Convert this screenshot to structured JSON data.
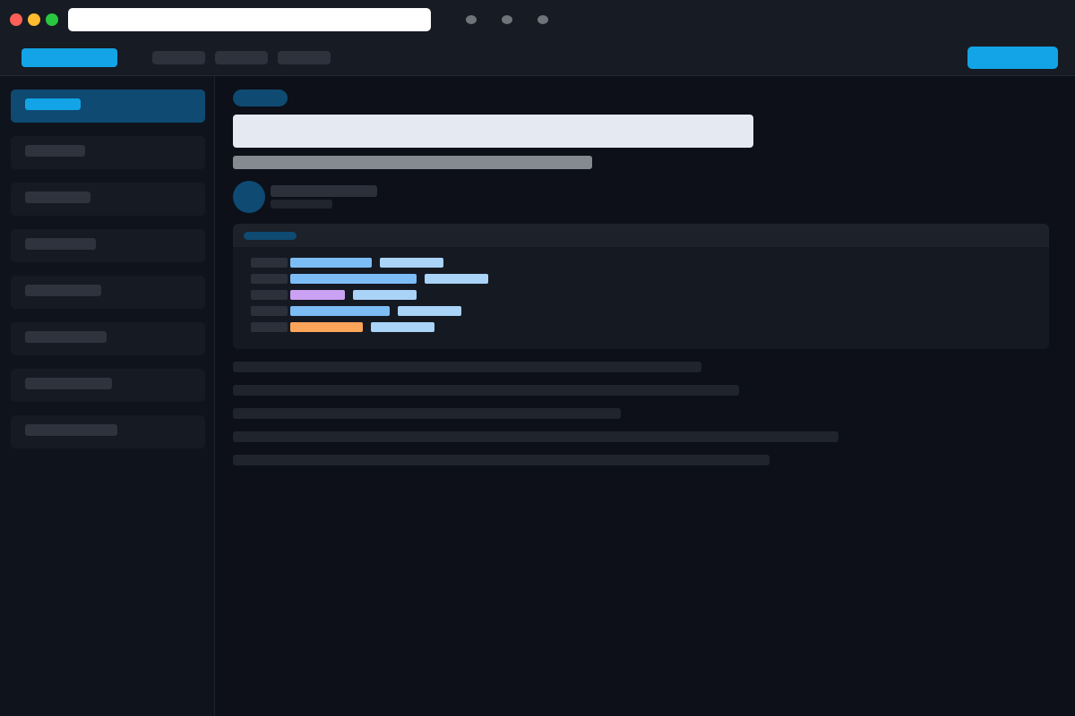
{
  "window": {
    "controls": [
      "close",
      "minimize",
      "maximize"
    ],
    "address_bar": {
      "value": ""
    },
    "toolbar_icons": [
      "dot-icon",
      "dot-icon",
      "dot-icon"
    ]
  },
  "header": {
    "brand": "",
    "nav_links": [
      "",
      "",
      ""
    ],
    "cta_label": ""
  },
  "sidebar": {
    "active_index": 0,
    "items": [
      {
        "label": ""
      },
      {
        "label": ""
      },
      {
        "label": ""
      },
      {
        "label": ""
      },
      {
        "label": ""
      },
      {
        "label": ""
      },
      {
        "label": ""
      },
      {
        "label": ""
      }
    ]
  },
  "article": {
    "tag": "",
    "title": "",
    "subtitle": "",
    "author": {
      "name": "",
      "meta": ""
    },
    "code_block": {
      "language": "",
      "lines": [
        {
          "number": "",
          "tokens": [
            {
              "kind": "keyword",
              "text": ""
            },
            {
              "kind": "string",
              "text": ""
            }
          ]
        },
        {
          "number": "",
          "tokens": [
            {
              "kind": "keyword",
              "text": ""
            },
            {
              "kind": "string",
              "text": ""
            }
          ]
        },
        {
          "number": "",
          "tokens": [
            {
              "kind": "function",
              "text": ""
            },
            {
              "kind": "string",
              "text": ""
            }
          ]
        },
        {
          "number": "",
          "tokens": [
            {
              "kind": "keyword",
              "text": ""
            },
            {
              "kind": "string",
              "text": ""
            }
          ]
        },
        {
          "number": "",
          "tokens": [
            {
              "kind": "number",
              "text": ""
            },
            {
              "kind": "string",
              "text": ""
            }
          ]
        }
      ]
    },
    "paragraphs": [
      "",
      "",
      "",
      "",
      ""
    ]
  },
  "colors": {
    "accent": "#12a4e6",
    "accent_dark": "#0e4a72",
    "background": "#0d1018",
    "surface": "#171b24",
    "title_text": "#e5eaf2",
    "token_keyword": "#7dbdf5",
    "token_string": "#a9d3f7",
    "token_function": "#cba1f3",
    "token_number": "#fba55a",
    "traffic_close": "#ff5f57",
    "traffic_minimize": "#febc2e",
    "traffic_maximize": "#28c840"
  }
}
